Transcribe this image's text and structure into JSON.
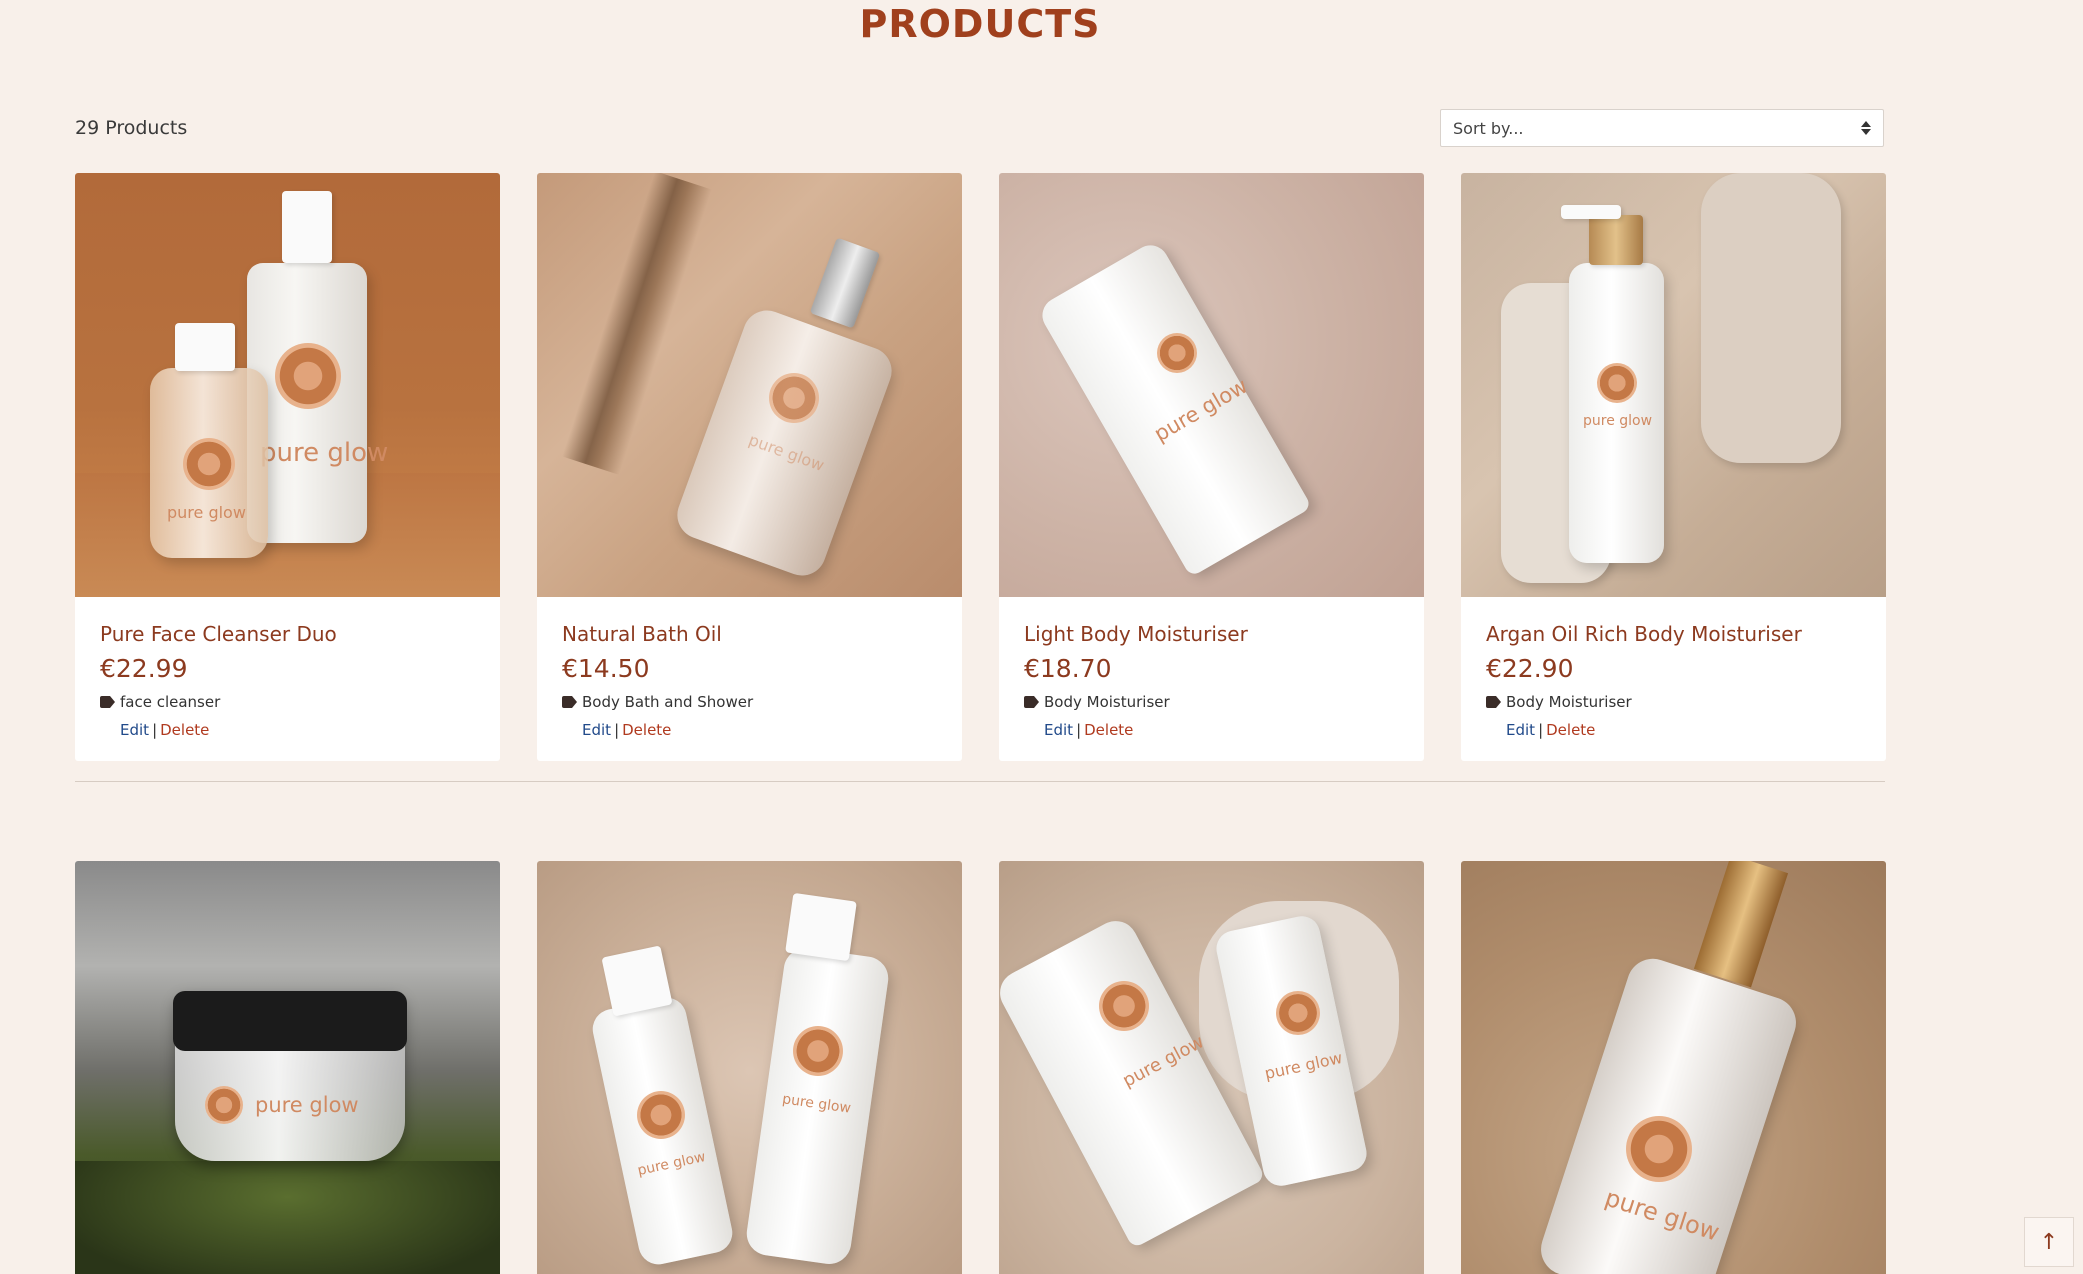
{
  "page": {
    "title": "PRODUCTS"
  },
  "toolbar": {
    "count_text": "29 Products",
    "sort_label": "Sort by..."
  },
  "products": [
    {
      "name": "Pure Face Cleanser Duo",
      "price": "€22.99",
      "category": "face cleanser",
      "edit": "Edit",
      "sep": "|",
      "delete": "Delete",
      "logo": "pure glow"
    },
    {
      "name": "Natural Bath Oil",
      "price": "€14.50",
      "category": "Body Bath and Shower",
      "edit": "Edit",
      "sep": "|",
      "delete": "Delete",
      "logo": "pure glow"
    },
    {
      "name": "Light Body Moisturiser",
      "price": "€18.70",
      "category": "Body Moisturiser",
      "edit": "Edit",
      "sep": "|",
      "delete": "Delete",
      "logo": "pure glow"
    },
    {
      "name": "Argan Oil Rich Body Moisturiser",
      "price": "€22.90",
      "category": "Body Moisturiser",
      "edit": "Edit",
      "sep": "|",
      "delete": "Delete",
      "logo": "pure glow"
    }
  ],
  "row2_logos": [
    "pure glow",
    "pure glow",
    "pure glow",
    "pure glow"
  ],
  "scroll_top": {
    "icon": "arrow-up-icon",
    "glyph": "↑"
  },
  "colors": {
    "accent": "#8c3a1f",
    "title": "#a0401d",
    "background": "#f8f0ea",
    "edit_link": "#214a8a",
    "delete_link": "#b03a1f"
  }
}
